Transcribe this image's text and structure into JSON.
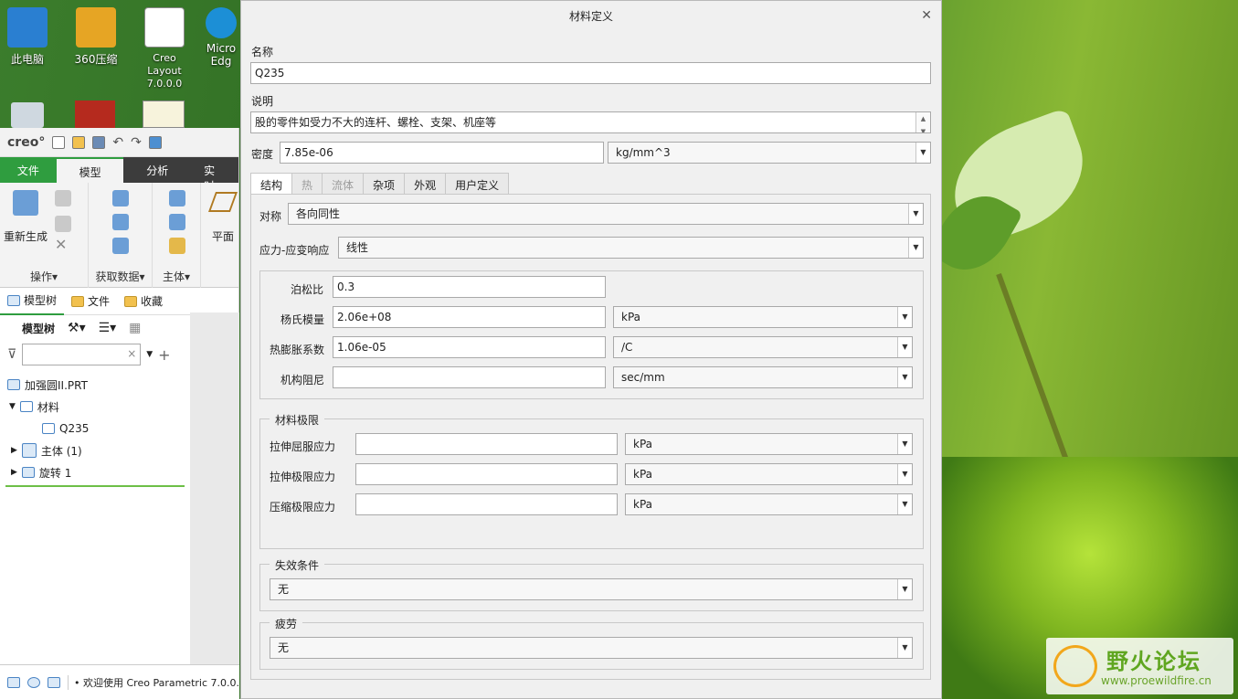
{
  "desktop": {
    "icons": [
      {
        "name": "this-pc",
        "label": "此电脑"
      },
      {
        "name": "zip",
        "label": "360压缩"
      },
      {
        "name": "creo-layout",
        "label": "Creo Layout 7.0.0.0"
      },
      {
        "name": "edge",
        "label": "Micro Edg"
      }
    ]
  },
  "creo": {
    "logo": "creo°",
    "tabs": [
      "文件",
      "模型",
      "分析",
      "实时仿"
    ],
    "ribbon": {
      "regen_label": "重新生成",
      "plane_label": "平面",
      "groups": [
        "操作▾",
        "获取数据▾",
        "主体▾"
      ]
    },
    "panel_tabs": [
      "模型树",
      "文件",
      "收藏"
    ],
    "tree_toolbar_label": "模型树",
    "tree": {
      "root": "加强圆II.PRT",
      "material": "材料",
      "material_child": "Q235",
      "body": "主体 (1)",
      "revolve": "旋转 1"
    },
    "status": "欢迎使用 Creo Parametric 7.0.0."
  },
  "dialog": {
    "title": "材料定义",
    "name_label": "名称",
    "name_value": "Q235",
    "desc_label": "说明",
    "desc_value": "股的零件如受力不大的连杆、螺栓、支架、机座等",
    "density_label": "密度",
    "density_value": "7.85e-06",
    "density_unit": "kg/mm^3",
    "tabs": [
      {
        "label": "结构",
        "state": "active"
      },
      {
        "label": "热",
        "state": "disabled"
      },
      {
        "label": "流体",
        "state": "disabled"
      },
      {
        "label": "杂项",
        "state": "normal"
      },
      {
        "label": "外观",
        "state": "normal"
      },
      {
        "label": "用户定义",
        "state": "normal"
      }
    ],
    "symmetry_label": "对称",
    "symmetry_value": "各向同性",
    "stress_label": "应力-应变响应",
    "stress_value": "线性",
    "poisson_label": "泊松比",
    "poisson_value": "0.3",
    "young_label": "杨氏模量",
    "young_value": "2.06e+08",
    "young_unit": "kPa",
    "thermal_label": "热膨胀系数",
    "thermal_value": "1.06e-05",
    "thermal_unit": "/C",
    "damping_label": "机构阻尼",
    "damping_value": "",
    "damping_unit": "sec/mm",
    "limits_title": "材料极限",
    "tensile_yield_label": "拉伸屈服应力",
    "tensile_yield_value": "",
    "tensile_yield_unit": "kPa",
    "tensile_ult_label": "拉伸极限应力",
    "tensile_ult_value": "",
    "tensile_ult_unit": "kPa",
    "comp_ult_label": "压缩极限应力",
    "comp_ult_value": "",
    "comp_ult_unit": "kPa",
    "failure_title": "失效条件",
    "failure_value": "无",
    "fatigue_title": "疲劳",
    "fatigue_value": "无"
  },
  "watermark": {
    "brand": "野火论坛",
    "url": "www.proewildfire.cn"
  },
  "colors": {
    "creo_green": "#2f9d3f",
    "dialog_bg": "#f0f0f0"
  }
}
